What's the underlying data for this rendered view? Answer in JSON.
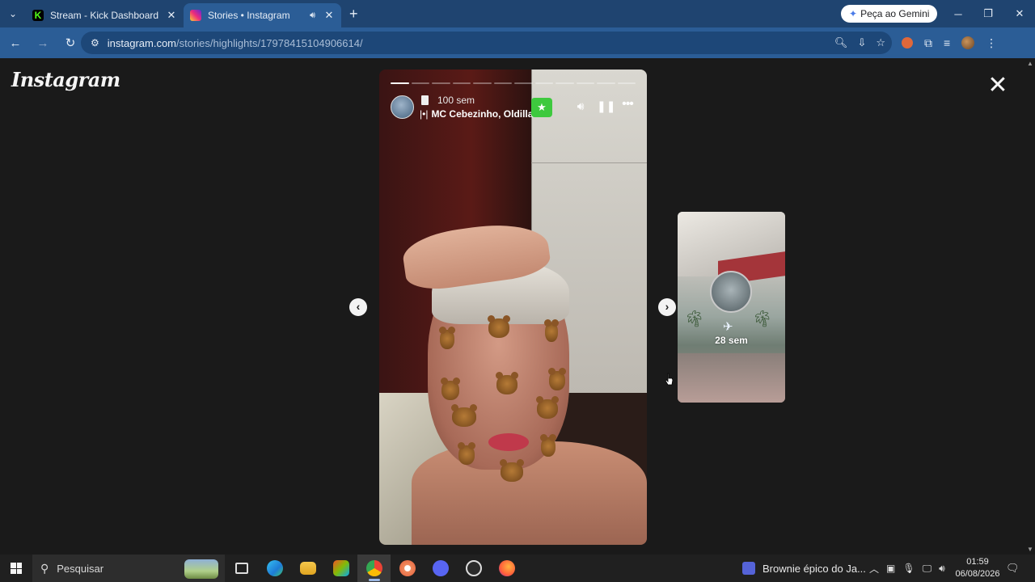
{
  "browser": {
    "tabs": [
      {
        "title": "Stream - Kick Dashboard",
        "active": false
      },
      {
        "title": "Stories • Instagram",
        "active": true,
        "playing_audio": true
      }
    ],
    "gemini_button": "Peça ao Gemini",
    "url_host": "instagram.com",
    "url_path": "/stories/highlights/17978415104906614/"
  },
  "instagram": {
    "logo": "Instagram",
    "story": {
      "time_ago": "100 sem",
      "music": "MC Cebezinho, Oldilla",
      "segments_total": 12,
      "segments_done": 1
    },
    "next_story": {
      "time_ago": "28 sem"
    }
  },
  "taskbar": {
    "search_placeholder": "Pesquisar",
    "media_title": "Brownie épico do Ja...",
    "time": "01:59",
    "date": "06/08/2026"
  },
  "colors": {
    "chrome_tabbar": "#1f4470",
    "chrome_toolbar": "#2b5d96",
    "page_bg": "#1a1a1a",
    "close_friends": "#3ec93e"
  }
}
